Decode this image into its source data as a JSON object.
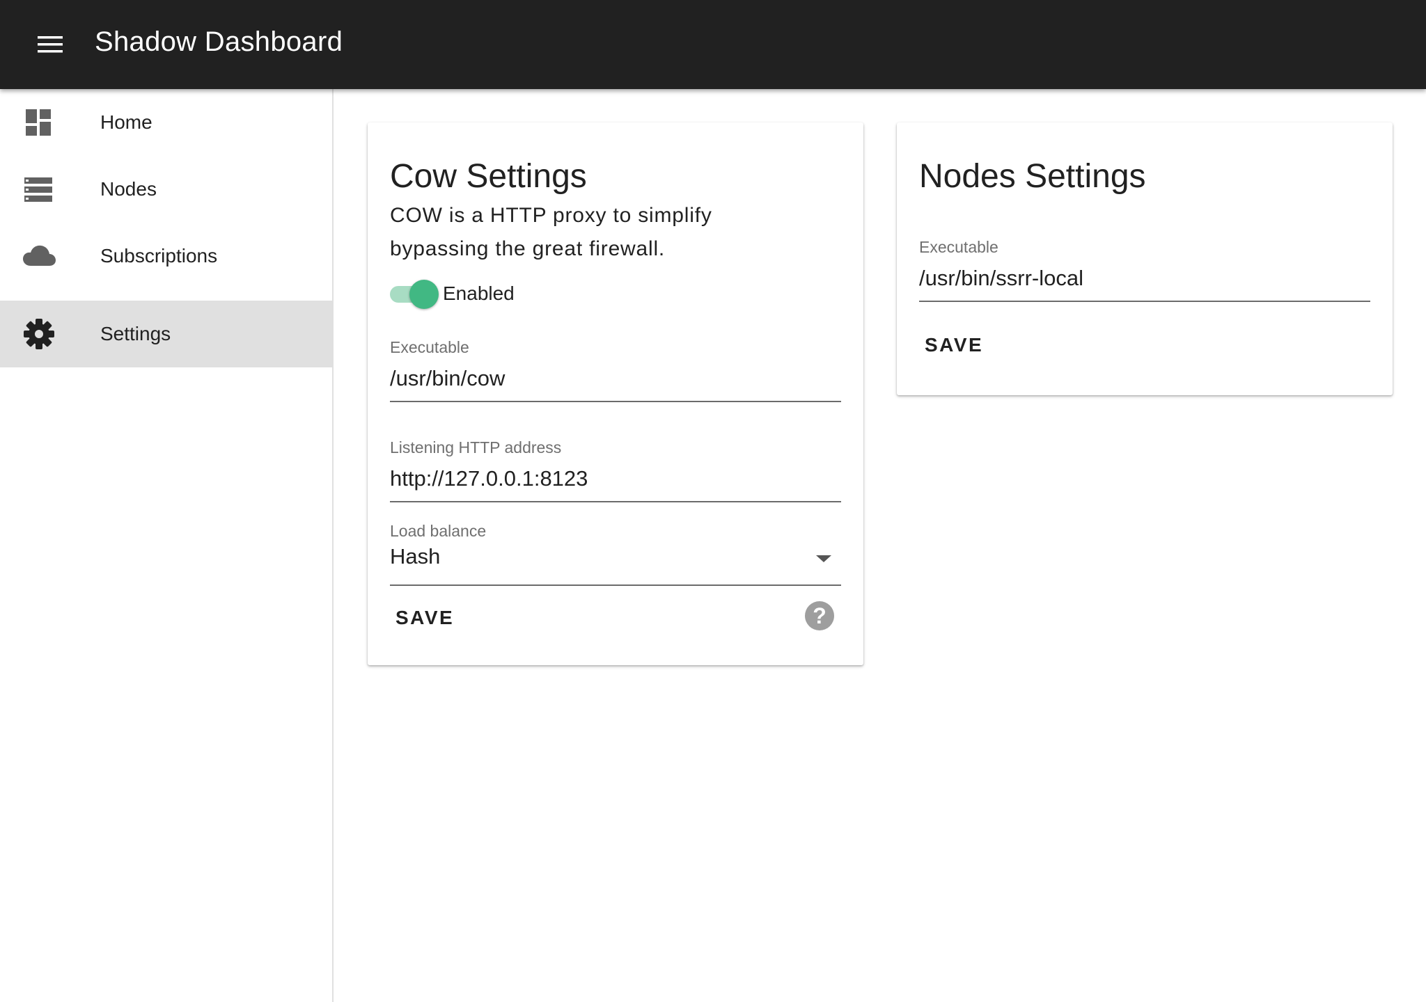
{
  "app": {
    "title": "Shadow Dashboard",
    "menu_icon": "menu-icon"
  },
  "sidebar": {
    "items": [
      {
        "label": "Home",
        "icon": "dashboard-icon",
        "active": false
      },
      {
        "label": "Nodes",
        "icon": "list-icon",
        "active": false
      },
      {
        "label": "Subscriptions",
        "icon": "cloud-icon",
        "active": false
      },
      {
        "label": "Settings",
        "icon": "gear-icon",
        "active": true
      }
    ]
  },
  "cow_settings": {
    "title": "Cow Settings",
    "description_line1": "COW is a HTTP proxy to simplify",
    "description_line2": "bypassing the great firewall.",
    "toggle_label": "Enabled",
    "enabled": true,
    "executable_label": "Executable",
    "executable_value": "/usr/bin/cow",
    "listen_label": "Listening HTTP address",
    "listen_value": "http://127.0.0.1:8123",
    "load_balance_label": "Load balance",
    "load_balance_value": "Hash",
    "save_label": "SAVE",
    "help_glyph": "?"
  },
  "nodes_settings": {
    "title": "Nodes Settings",
    "executable_label": "Executable",
    "executable_value": "/usr/bin/ssrr-local",
    "save_label": "SAVE"
  },
  "colors": {
    "appbar": "#212121",
    "accent": "#41b883",
    "active_nav": "#e0e0e0"
  }
}
